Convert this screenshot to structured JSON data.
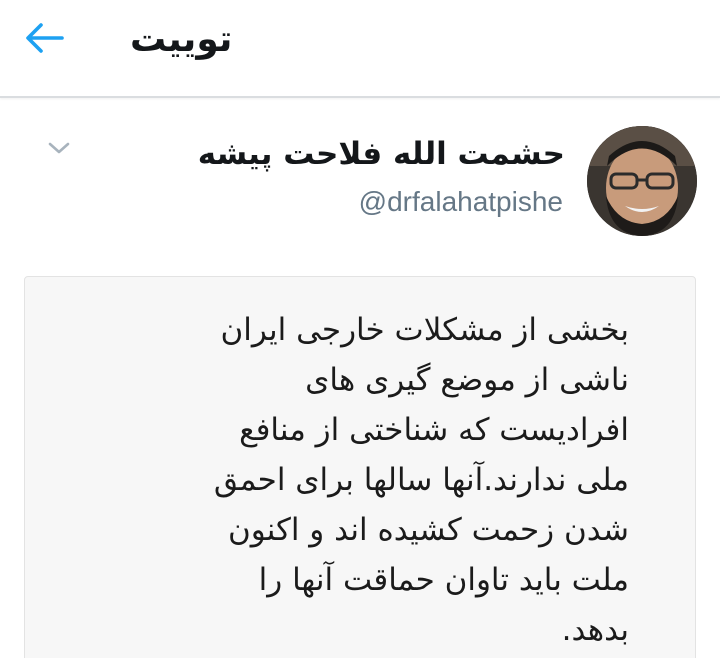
{
  "topbar": {
    "title": "توییت",
    "back_icon": "arrow-left-icon",
    "accent_color": "#1da1f2"
  },
  "author": {
    "display_name": "حشمت الله فلاحت پیشه",
    "username": "@drfalahatpishe",
    "avatar_icon": "avatar-photo",
    "menu_icon": "chevron-down-icon"
  },
  "tweet": {
    "lines": [
      "بخشی از مشکلات خارجی ایران",
      "ناشی از موضع گیری های",
      "افرادیست که شناختی از منافع",
      "ملی ندارند.آنها سالها برای احمق",
      "شدن زحمت کشیده اند و اکنون",
      "ملت باید تاوان حماقت آنها را",
      "بدهد."
    ]
  }
}
